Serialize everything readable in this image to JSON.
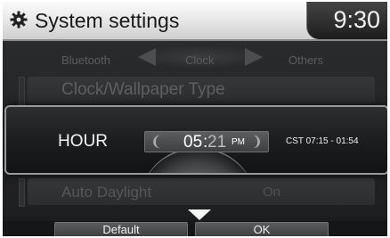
{
  "header": {
    "title": "System settings",
    "clock": "9:30",
    "icon": "gear-icon"
  },
  "tabs": [
    {
      "label": "Bluetooth"
    },
    {
      "label": "Clock"
    },
    {
      "label": "Others"
    }
  ],
  "settings": [
    {
      "label": "Clock/Wallpaper Type"
    },
    {
      "label": "Auto Daylight",
      "value": "On"
    }
  ],
  "popup": {
    "label": "HOUR",
    "time": {
      "hour": "05",
      "separator": ":",
      "minute": "21",
      "ampm": "PM"
    },
    "info": "CST 07:15 - 01:54"
  },
  "buttons": {
    "default": "Default",
    "ok": "OK"
  },
  "colors": {
    "header_bg": "#e9e9e9",
    "screen_bg": "#1b1c1d",
    "popup_border": "#9a9a9a",
    "text_light": "#f4f4f4"
  }
}
